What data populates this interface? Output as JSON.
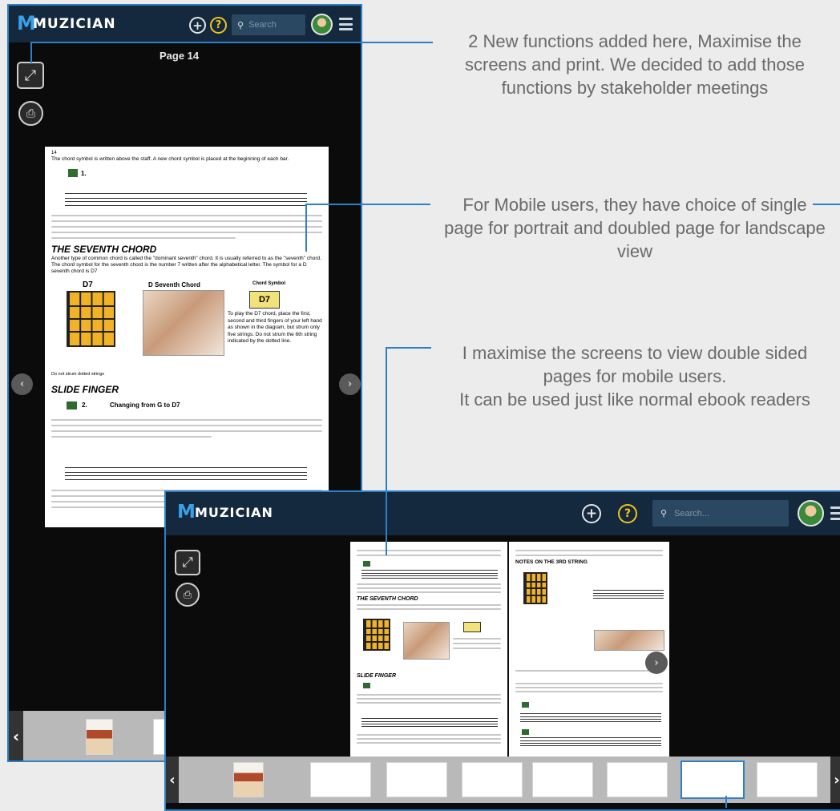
{
  "app": {
    "brand_mark": "M",
    "brand_name": "MUZICIAN"
  },
  "icons": {
    "add": "add-circle-icon",
    "help": "help-question-icon",
    "search": "search-icon",
    "menu": "hamburger-menu-icon",
    "maximise": "maximise-screen-icon",
    "print": "print-icon",
    "prev": "chevron-left-icon",
    "next": "chevron-right-icon"
  },
  "colors": {
    "frame_border": "#2d7fc7",
    "header_bg": "#14283e",
    "brand_accent": "#3aa0e6",
    "help_accent": "#f0c419"
  },
  "portrait": {
    "search_placeholder": "Search",
    "page_label": "Page 14",
    "book_page": {
      "page_number": "14",
      "intro": "The chord symbol is written above the staff. A new chord symbol is placed at the beginning of each bar.",
      "example_1": "1.",
      "seventh_heading": "THE SEVENTH CHORD",
      "seventh_text": "Another type of common chord is called the \"dominant seventh\" chord. It is usually referred to as the \"seventh\" chord. The chord symbol for the seventh chord is the number 7 written after the alphabetical letter. The symbol for a D seventh chord is D7",
      "chord_label_d7": "D7",
      "chord_caption": "D Seventh Chord",
      "chord_symbol_label": "Chord Symbol",
      "chord_symbol_value": "D7",
      "d7_text": "To play the D7 chord, place the first, second and third fingers of your left hand as shown in the diagram, but strum only five strings. Do not strum the 6th string indicated by the dotted line.",
      "do_not_strum": "Do not strum dotted strings",
      "slide_heading": "SLIDE FINGER",
      "example_2": "2.",
      "example_2_title": "Changing from G to D7"
    }
  },
  "landscape": {
    "search_placeholder": "Search...",
    "right_page_heading": "NOTES ON THE 3RD STRING",
    "left_page_heading": "THE SEVENTH CHORD",
    "left_page_subheading": "SLIDE FINGER"
  },
  "annotations": [
    {
      "text": "2 New functions added here, Maximise the screens and print. We decided to add those functions by stakeholder meetings"
    },
    {
      "text": "For Mobile users, they have choice of single page for portrait and doubled page for landscape view"
    },
    {
      "text": "I maximise the screens to view double sided pages for mobile users.\nIt can be used just like normal ebook readers"
    }
  ]
}
